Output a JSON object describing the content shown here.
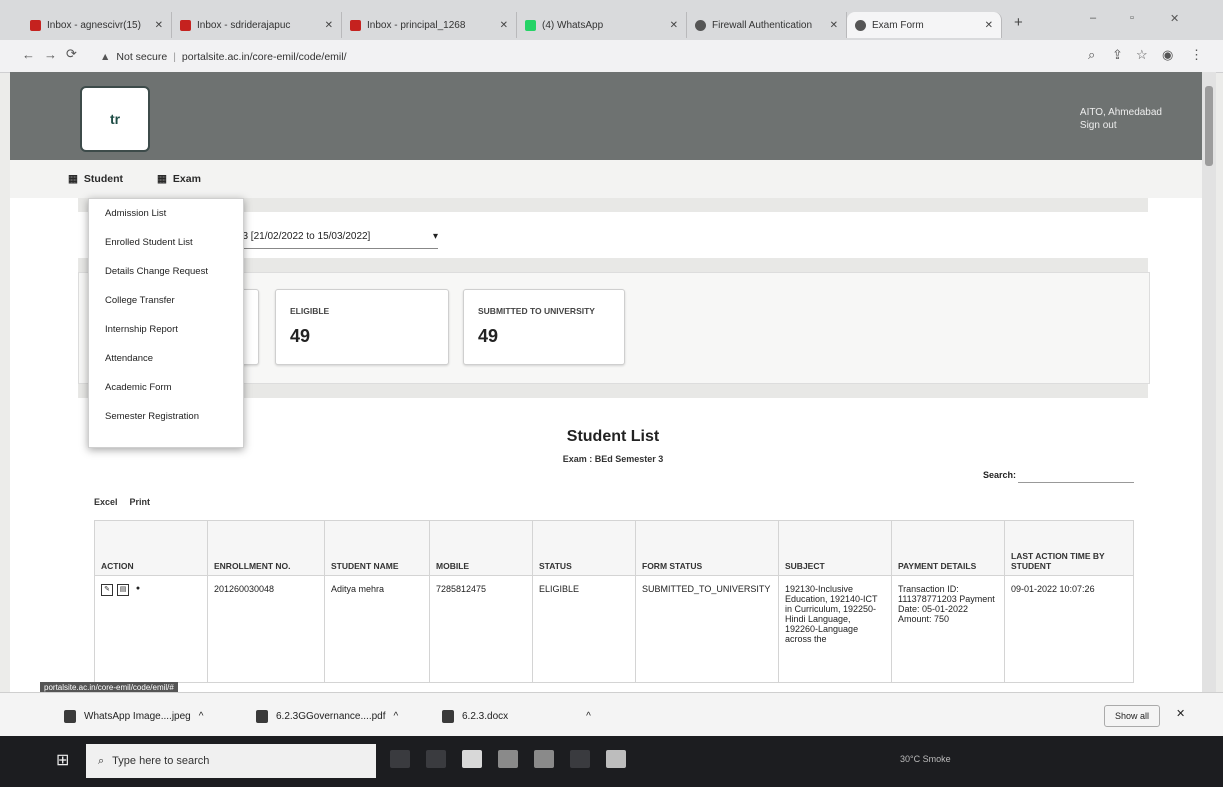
{
  "browser": {
    "tabs": [
      {
        "label": "Inbox - agnescivr(15)",
        "icon": "gmail-icon",
        "color": "#c5221f"
      },
      {
        "label": "Inbox - sdriderajapuc",
        "icon": "gmail-icon",
        "color": "#c5221f"
      },
      {
        "label": "Inbox - principal_1268",
        "icon": "gmail-icon",
        "color": "#c5221f"
      },
      {
        "label": "(4) WhatsApp",
        "icon": "whatsapp-icon",
        "color": "#25d366"
      },
      {
        "label": "Firewall Authentication",
        "icon": "globe-icon",
        "color": "#555555"
      },
      {
        "label": "Exam Form",
        "icon": "globe-icon",
        "color": "#555555"
      }
    ],
    "address": {
      "security": "Not secure",
      "url": "portalsite.ac.in/core-emil/code/emil/"
    },
    "window_controls": [
      "–",
      "▫",
      "✕"
    ]
  },
  "site": {
    "logo_text": "tr",
    "user_location": "AITO, Ahmedabad",
    "signout": "Sign out",
    "menu": [
      {
        "label": "Student",
        "icon": "grid-icon"
      },
      {
        "label": "Exam",
        "icon": "grid-icon"
      }
    ]
  },
  "filter": {
    "value": "ter 3 [21/02/2022 to 15/03/2022]"
  },
  "student_menu": [
    "Admission List",
    "Enrolled Student List",
    "Details Change Request",
    "College Transfer",
    "Internship Report",
    "Attendance",
    "Academic Form",
    "Semester Registration"
  ],
  "stats": [
    {
      "label": "ELIGIBLE",
      "value": "49"
    },
    {
      "label": "SUBMITTED TO UNIVERSITY",
      "value": "49"
    }
  ],
  "list": {
    "title": "Student List",
    "subtitle": "Exam : BEd Semester 3",
    "search_label": "Search:",
    "buttons": [
      "Excel",
      "Print"
    ],
    "columns": [
      "ACTION",
      "ENROLLMENT NO.",
      "STUDENT NAME",
      "MOBILE",
      "STATUS",
      "FORM STATUS",
      "SUBJECT",
      "PAYMENT DETAILS",
      "LAST ACTION TIME BY STUDENT"
    ],
    "rows": [
      {
        "enrollment": "201260030048",
        "name": "Aditya mehra",
        "mobile": "7285812475",
        "status": "ELIGIBLE",
        "form_status": "SUBMITTED_TO_UNIVERSITY",
        "subject": "192130-Inclusive Education, 192140-ICT in Curriculum, 192250-Hindi Language, 192260-Language across the",
        "payment": "Transaction ID: 111378771203 Payment Date: 05-01-2022 Amount: 750",
        "last_action": "09-01-2022 10:07:26"
      }
    ]
  },
  "status_url": "portalsite.ac.in/core-emil/code/emil/#",
  "downloads": [
    {
      "name": "WhatsApp Image....jpeg"
    },
    {
      "name": "6.2.3GGovernance....pdf"
    },
    {
      "name": "6.2.3.docx"
    }
  ],
  "downloads_show_all": "Show all",
  "taskbar": {
    "search_placeholder": "Type here to search",
    "weather": "30°C Smoke"
  }
}
